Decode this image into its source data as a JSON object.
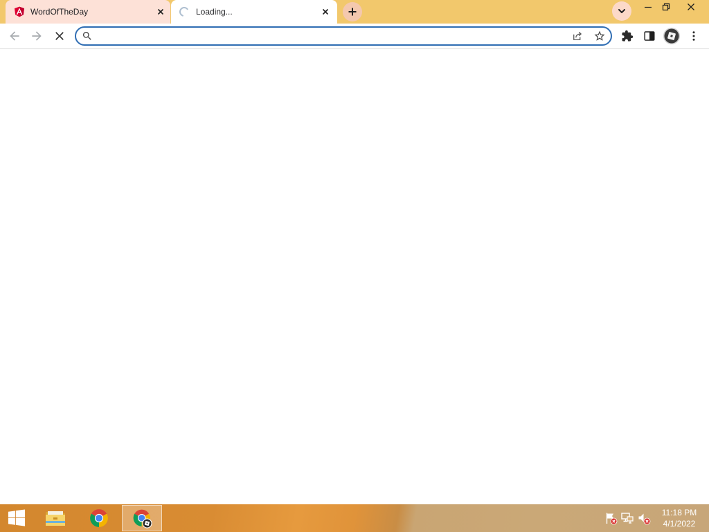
{
  "window": {
    "controls": {
      "minimize_icon": "minimize-icon",
      "restore_icon": "restore-icon",
      "close_icon": "window-close-icon"
    }
  },
  "tabs": [
    {
      "title": "WordOfTheDay",
      "favicon": "angular-icon",
      "active": false,
      "close_icon": "close-icon"
    },
    {
      "title": "Loading...",
      "favicon": "loading-spinner-icon",
      "active": true,
      "close_icon": "close-icon"
    }
  ],
  "new_tab": {
    "icon": "plus-icon"
  },
  "tab_search": {
    "icon": "chevron-down-icon"
  },
  "toolbar": {
    "back": {
      "icon": "back-arrow-icon",
      "enabled": false
    },
    "forward": {
      "icon": "forward-arrow-icon",
      "enabled": false
    },
    "stop": {
      "icon": "stop-icon"
    },
    "extensions": {
      "icon": "puzzle-icon"
    },
    "side_panel": {
      "icon": "side-panel-icon"
    },
    "profile": {
      "icon": "avatar-icon"
    },
    "menu": {
      "icon": "kebab-menu-icon"
    }
  },
  "omnibox": {
    "value": "",
    "search_icon": "search-icon",
    "share_icon": "share-icon",
    "bookmark_icon": "star-icon"
  },
  "taskbar": {
    "start": {
      "icon": "windows-logo-icon"
    },
    "apps": [
      {
        "icon": "file-explorer-icon",
        "active": false
      },
      {
        "icon": "chrome-icon",
        "active": false
      },
      {
        "icon": "chrome-profile-icon",
        "active": true
      }
    ],
    "tray": [
      {
        "icon": "action-center-flag-icon",
        "alert": true
      },
      {
        "icon": "network-icon",
        "alert": false
      },
      {
        "icon": "speaker-muted-icon",
        "alert": true
      }
    ],
    "clock": {
      "time": "11:18 PM",
      "date": "4/1/2022"
    }
  },
  "colors": {
    "tab_strip": "#f2c86c",
    "inactive_tab": "#fde1d7",
    "omnibox_border": "#2f6db3",
    "new_tab_button": "#f4c8ae",
    "tab_search_button": "#fcd9c8"
  }
}
